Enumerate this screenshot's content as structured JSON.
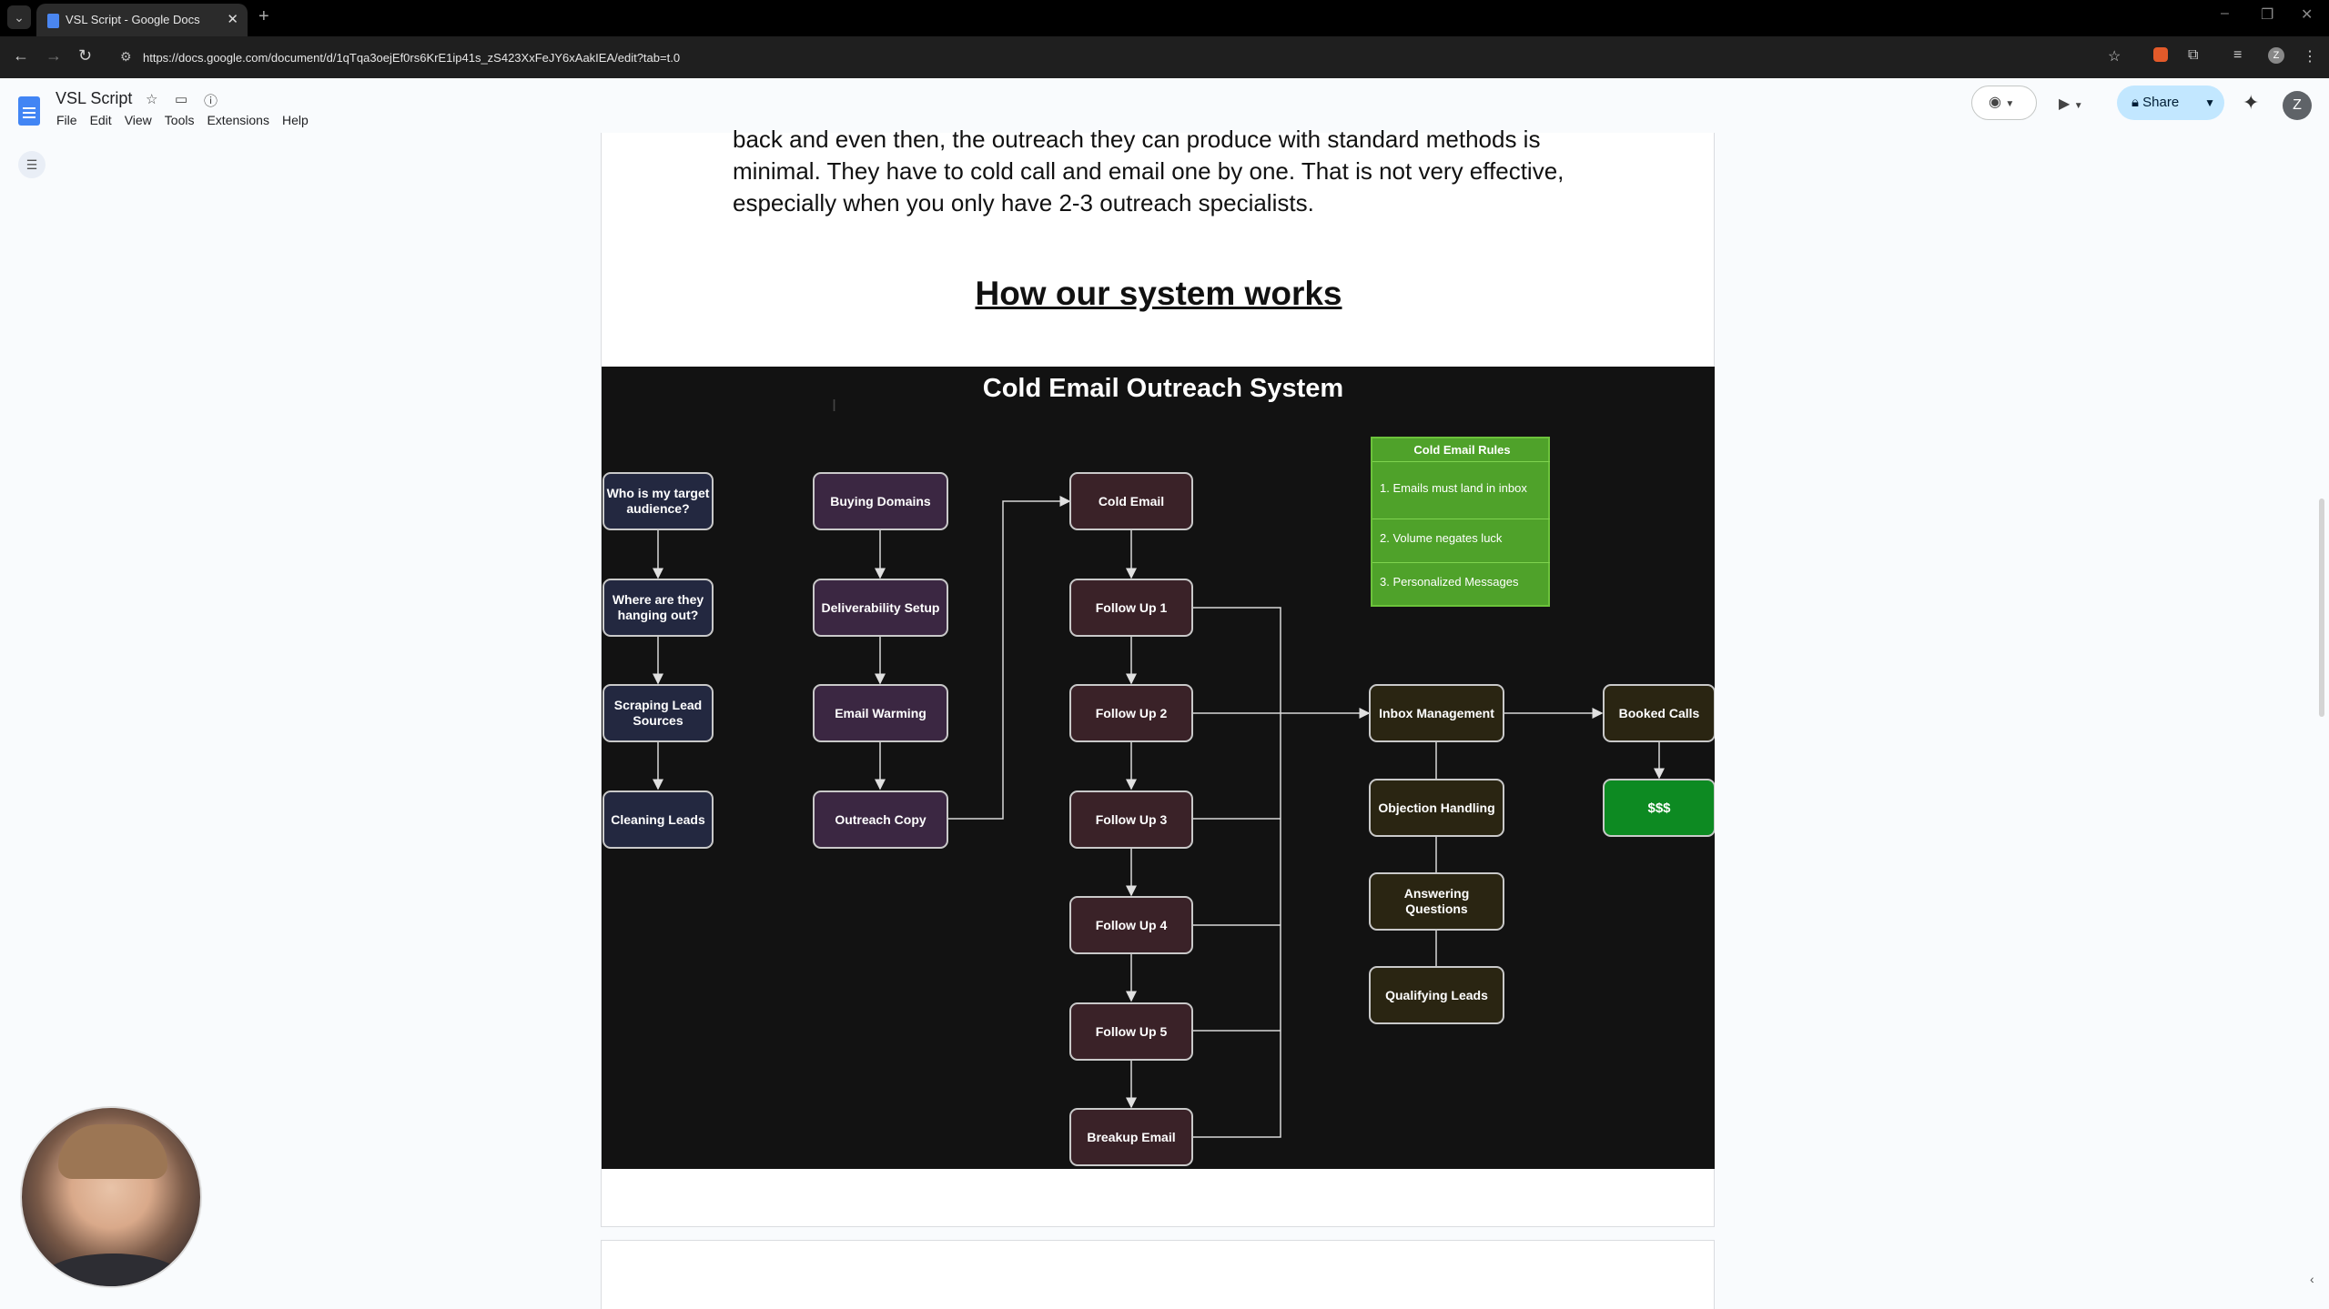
{
  "browser": {
    "tab_title": "VSL Script - Google Docs",
    "url": "https://docs.google.com/document/d/1qTqa3oejEf0rs6KrE1ip41s_zS423XxFeJY6xAakIEA/edit?tab=t.0"
  },
  "docs": {
    "title": "VSL Script",
    "menu": [
      "File",
      "Edit",
      "View",
      "Tools",
      "Extensions",
      "Help"
    ],
    "share_label": "Share",
    "avatar_letter": "Z"
  },
  "document": {
    "paragraph_lines": [
      "back and even then, the outreach they can produce with standard methods is",
      "minimal. They have to cold call and email one by one. That is not very effective,",
      "especially when you only have 2-3 outreach specialists."
    ],
    "heading": "How our system works"
  },
  "diagram": {
    "title": "Cold Email Outreach System",
    "audience_column": [
      "Who is my target audience?",
      "Where are they hanging out?",
      "Scraping Lead Sources",
      "Cleaning Leads"
    ],
    "setup_column": [
      "Buying Domains",
      "Deliverability Setup",
      "Email Warming",
      "Outreach Copy"
    ],
    "sequence_column": [
      "Cold Email",
      "Follow Up 1",
      "Follow Up 2",
      "Follow Up 3",
      "Follow Up 4",
      "Follow Up 5",
      "Breakup Email"
    ],
    "inbox_column": [
      "Inbox Management",
      "Objection Handling",
      "Answering Questions",
      "Qualifying Leads"
    ],
    "outcome_column": [
      "Booked Calls",
      "$$$"
    ],
    "rules": {
      "title": "Cold Email Rules",
      "items": [
        "1. Emails must land in inbox",
        "2. Volume negates luck",
        "3. Personalized Messages"
      ]
    },
    "colors": {
      "audience": "#232840",
      "setup": "#3b2742",
      "sequence": "#3a2228",
      "inbox": "#2a2512",
      "outcome_money": "#0d8a22",
      "rules_box": "#4fa22a"
    }
  }
}
